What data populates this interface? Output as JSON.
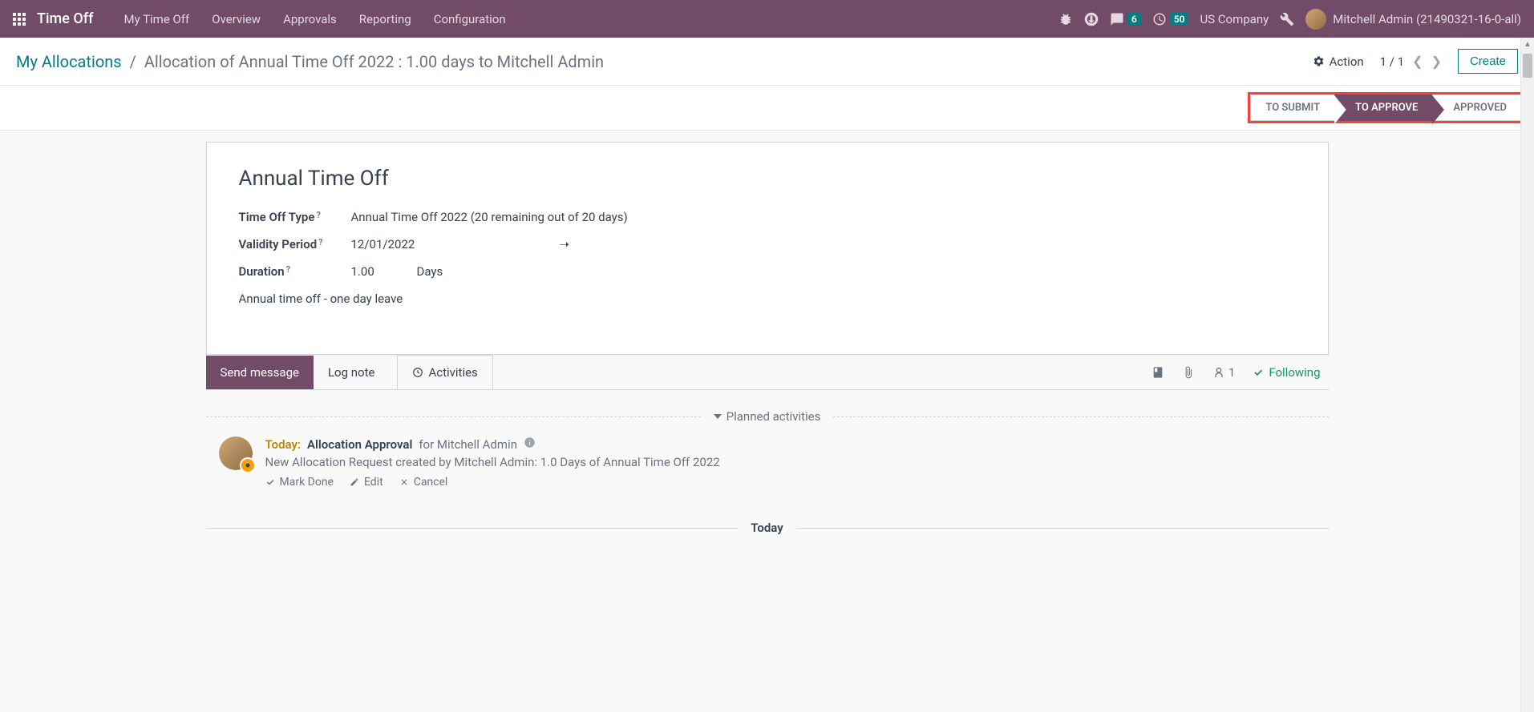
{
  "navbar": {
    "app_title": "Time Off",
    "menu": [
      "My Time Off",
      "Overview",
      "Approvals",
      "Reporting",
      "Configuration"
    ],
    "chat_badge": "6",
    "clock_badge": "50",
    "company": "US Company",
    "user": "Mitchell Admin (21490321-16-0-all)"
  },
  "breadcrumb": {
    "parent": "My Allocations",
    "current": "Allocation of Annual Time Off 2022 : 1.00 days to Mitchell Admin",
    "action_label": "Action",
    "pager": "1 / 1",
    "create_label": "Create"
  },
  "status": {
    "states": [
      "TO SUBMIT",
      "TO APPROVE",
      "APPROVED"
    ],
    "active_index": 1
  },
  "form": {
    "title": "Annual Time Off",
    "labels": {
      "type": "Time Off Type",
      "validity": "Validity Period",
      "duration": "Duration"
    },
    "type_value": "Annual Time Off 2022 (20 remaining out of 20 days)",
    "validity_from": "12/01/2022",
    "duration_value": "1.00",
    "duration_unit": "Days",
    "description": "Annual time off - one day leave"
  },
  "chatter": {
    "tabs": {
      "send": "Send message",
      "log": "Log note",
      "activities": "Activities"
    },
    "follower_count": "1",
    "following_label": "Following",
    "planned_header": "Planned activities",
    "today_header": "Today"
  },
  "activity": {
    "today_label": "Today:",
    "name": "Allocation Approval",
    "for": "for Mitchell Admin",
    "description": "New Allocation Request created by Mitchell Admin: 1.0 Days of Annual Time Off 2022",
    "actions": {
      "done": "Mark Done",
      "edit": "Edit",
      "cancel": "Cancel"
    }
  }
}
